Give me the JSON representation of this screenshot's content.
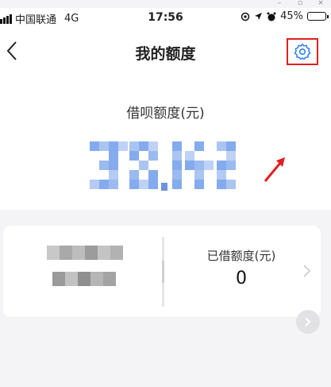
{
  "status_bar": {
    "carrier": "中国联通",
    "network": "4G",
    "time": "17:56",
    "battery": "45%",
    "battery_level": 0.45
  },
  "nav": {
    "title": "我的额度",
    "back_icon": "chevron-left-icon",
    "settings_icon": "gear-icon"
  },
  "credit": {
    "label": "借呗额度(元)"
  },
  "card": {
    "used_label": "已借额度(元)",
    "used_value": "0"
  },
  "colors": {
    "accent": "#2a7ef0",
    "highlight": "#e02020",
    "background": "#f4f4f6"
  }
}
